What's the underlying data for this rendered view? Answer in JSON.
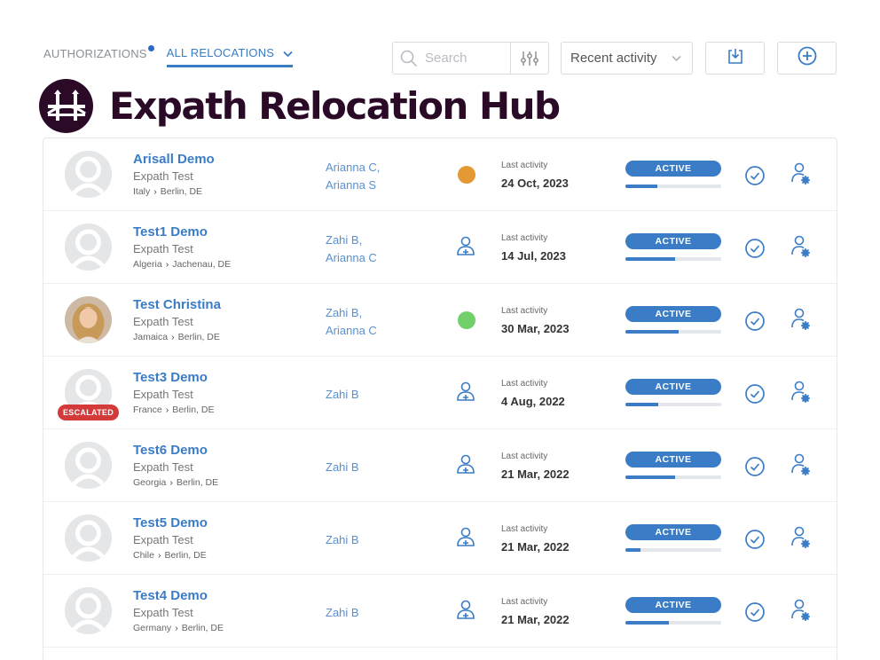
{
  "tabs": [
    {
      "label": "AUTHORIZATIONS",
      "has_notification": true
    },
    {
      "label": "ALL RELOCATIONS",
      "active": true
    }
  ],
  "search": {
    "placeholder": "Search"
  },
  "sort": {
    "selected": "Recent activity"
  },
  "brand": {
    "title": "Expath Relocation Hub"
  },
  "colors": {
    "accent": "#3a7cc5",
    "brand": "#2a0a26",
    "escalated": "#d43a3a",
    "orange": "#e39a34",
    "green": "#72d06a"
  },
  "rows": [
    {
      "name": "Arisall Demo",
      "company": "Expath Test",
      "from": "Italy",
      "to": "Berlin, DE",
      "consultants": [
        "Arianna C,",
        "Arianna S"
      ],
      "indicator": "orange-dot",
      "last_activity_label": "Last activity",
      "last_activity": "24 Oct, 2023",
      "status": "ACTIVE",
      "progress": 0.33,
      "avatar": "placeholder"
    },
    {
      "name": "Test1 Demo",
      "company": "Expath Test",
      "from": "Algeria",
      "to": "Jachenau, DE",
      "consultants": [
        "Zahi B,",
        "Arianna C"
      ],
      "indicator": "assign-icon",
      "last_activity_label": "Last activity",
      "last_activity": "14 Jul, 2023",
      "status": "ACTIVE",
      "progress": 0.52,
      "avatar": "placeholder"
    },
    {
      "name": "Test Christina",
      "company": "Expath Test",
      "from": "Jamaica",
      "to": "Berlin, DE",
      "consultants": [
        "Zahi B,",
        "Arianna C"
      ],
      "indicator": "green-dot",
      "last_activity_label": "Last activity",
      "last_activity": "30 Mar, 2023",
      "status": "ACTIVE",
      "progress": 0.56,
      "avatar": "photo"
    },
    {
      "name": "Test3 Demo",
      "company": "Expath Test",
      "from": "France",
      "to": "Berlin, DE",
      "consultants": [
        "Zahi B"
      ],
      "indicator": "assign-icon",
      "last_activity_label": "Last activity",
      "last_activity": "4 Aug, 2022",
      "status": "ACTIVE",
      "progress": 0.34,
      "avatar": "placeholder",
      "escalated": "ESCALATED"
    },
    {
      "name": "Test6 Demo",
      "company": "Expath Test",
      "from": "Georgia",
      "to": "Berlin, DE",
      "consultants": [
        "Zahi B"
      ],
      "indicator": "assign-icon",
      "last_activity_label": "Last activity",
      "last_activity": "21 Mar, 2022",
      "status": "ACTIVE",
      "progress": 0.52,
      "avatar": "placeholder"
    },
    {
      "name": "Test5 Demo",
      "company": "Expath Test",
      "from": "Chile",
      "to": "Berlin, DE",
      "consultants": [
        "Zahi B"
      ],
      "indicator": "assign-icon",
      "last_activity_label": "Last activity",
      "last_activity": "21 Mar, 2022",
      "status": "ACTIVE",
      "progress": 0.16,
      "avatar": "placeholder"
    },
    {
      "name": "Test4 Demo",
      "company": "Expath Test",
      "from": "Germany",
      "to": "Berlin, DE",
      "consultants": [
        "Zahi B"
      ],
      "indicator": "assign-icon",
      "last_activity_label": "Last activity",
      "last_activity": "21 Mar, 2022",
      "status": "ACTIVE",
      "progress": 0.45,
      "avatar": "placeholder"
    }
  ]
}
